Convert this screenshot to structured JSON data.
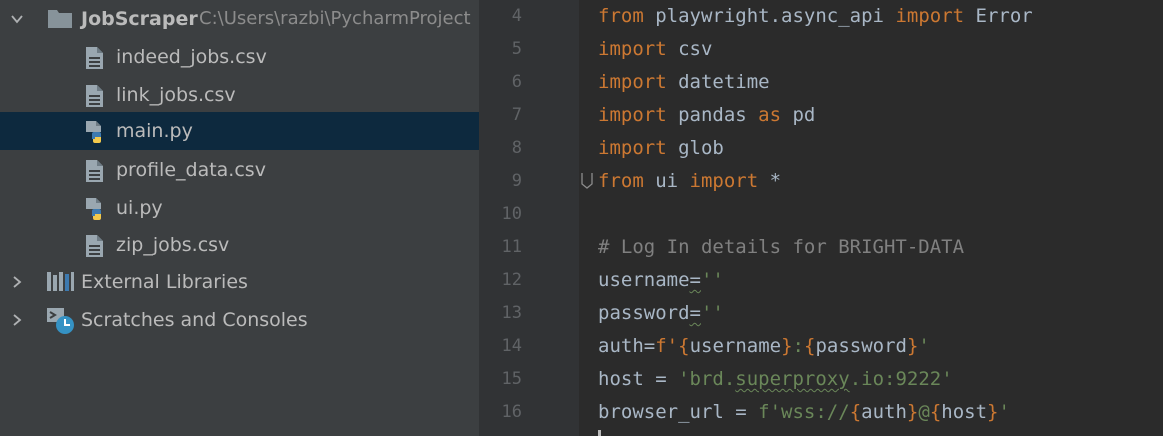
{
  "project_tree": {
    "root": {
      "label": "JobScraper",
      "path": "C:\\Users\\razbi\\PycharmProject"
    },
    "files": [
      {
        "label": "indeed_jobs.csv",
        "icon": "csv-file-icon"
      },
      {
        "label": "link_jobs.csv",
        "icon": "csv-file-icon"
      },
      {
        "label": "main.py",
        "icon": "python-file-icon",
        "selected": true
      },
      {
        "label": "profile_data.csv",
        "icon": "csv-file-icon"
      },
      {
        "label": "ui.py",
        "icon": "python-file-icon"
      },
      {
        "label": "zip_jobs.csv",
        "icon": "csv-file-icon"
      }
    ],
    "external_libraries": {
      "label": "External Libraries",
      "icon": "library-icon"
    },
    "scratches": {
      "label": "Scratches and Consoles",
      "icon": "scratches-icon"
    }
  },
  "editor": {
    "line_numbers": [
      "4",
      "5",
      "6",
      "7",
      "8",
      "9",
      "10",
      "11",
      "12",
      "13",
      "14",
      "15",
      "16"
    ],
    "lines": [
      {
        "kw1": "from",
        "mod": " playwright.async_api ",
        "kw2": "import",
        "name": " Error"
      },
      {
        "kw1": "import",
        "mod": " csv"
      },
      {
        "kw1": "import",
        "mod": " datetime"
      },
      {
        "kw1": "import",
        "mod": " pandas ",
        "kw2": "as",
        "name": " pd"
      },
      {
        "kw1": "import",
        "mod": " glob"
      },
      {
        "kw1": "from",
        "mod": " ui ",
        "kw2": "import",
        "name": " *"
      },
      {},
      {
        "comment": "# Log In details for BRIGHT-DATA"
      },
      {
        "var": "username",
        "op": "=",
        "val": "''"
      },
      {
        "var": "password",
        "op": "=",
        "val": "''"
      },
      {
        "var": "auth",
        "op": "=",
        "prefix": "f'",
        "b1": "{",
        "n1": "username",
        "b2": "}",
        "sep": ":",
        "b3": "{",
        "n2": "password",
        "b4": "}",
        "suffix": "'"
      },
      {
        "var": "host",
        "op": " = ",
        "s1": "'brd.",
        "s2": "superproxy",
        "s3": ".io:9222'"
      },
      {
        "var": "browser_url",
        "op": " = ",
        "prefix": "f'wss://",
        "b1": "{",
        "n1": "auth",
        "b2": "}",
        "sep": "@",
        "b3": "{",
        "n2": "host",
        "b4": "}",
        "suffix": "'"
      }
    ]
  },
  "colors": {
    "panel": "#3c3f41",
    "editor_bg": "#2b2b2b",
    "gutter": "#313335",
    "selection": "#0d293e",
    "keyword": "#cc7832",
    "string": "#6a8759",
    "comment": "#808080",
    "text": "#a9b7c6"
  }
}
